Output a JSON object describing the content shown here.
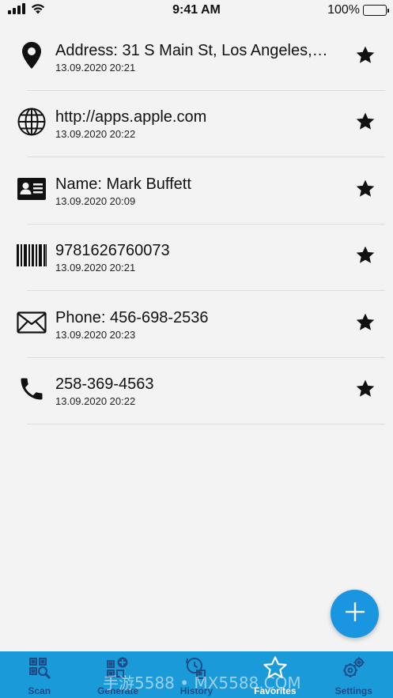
{
  "status_bar": {
    "time": "9:41 AM",
    "battery_percent": "100%",
    "signal_icon": "signal-bars-icon",
    "wifi_icon": "wifi-icon",
    "battery_icon": "battery-icon"
  },
  "list": {
    "items": [
      {
        "icon": "location-pin-icon",
        "title": "Address: 31 S Main St, Los Angeles, 9...",
        "date": "13.09.2020 20:21",
        "favorite": true
      },
      {
        "icon": "globe-icon",
        "title": "http://apps.apple.com",
        "date": "13.09.2020 20:22",
        "favorite": true
      },
      {
        "icon": "contact-card-icon",
        "title": "Name: Mark Buffett",
        "date": "13.09.2020 20:09",
        "favorite": true
      },
      {
        "icon": "barcode-icon",
        "title": "9781626760073",
        "date": "13.09.2020 20:21",
        "favorite": true
      },
      {
        "icon": "envelope-icon",
        "title": "Phone: 456-698-2536",
        "date": "13.09.2020 20:23",
        "favorite": true
      },
      {
        "icon": "phone-icon",
        "title": "258-369-4563",
        "date": "13.09.2020 20:22",
        "favorite": true
      }
    ]
  },
  "fab": {
    "icon": "plus-icon"
  },
  "tab_bar": {
    "tabs": [
      {
        "label": "Scan",
        "icon": "scan-qr-icon",
        "active": false
      },
      {
        "label": "Generate",
        "icon": "generate-qr-icon",
        "active": false
      },
      {
        "label": "History",
        "icon": "history-icon",
        "active": false
      },
      {
        "label": "Favorites",
        "icon": "star-outline-icon",
        "active": true
      },
      {
        "label": "Settings",
        "icon": "gears-icon",
        "active": false
      }
    ]
  },
  "watermark": "手游5588 • MX5588.COM",
  "colors": {
    "background": "#f3f3f3",
    "tab_bar": "#1a9ad9",
    "tab_label_inactive": "#1d4d86",
    "tab_label_active": "#ffffff",
    "fab": "#1a96e0"
  }
}
